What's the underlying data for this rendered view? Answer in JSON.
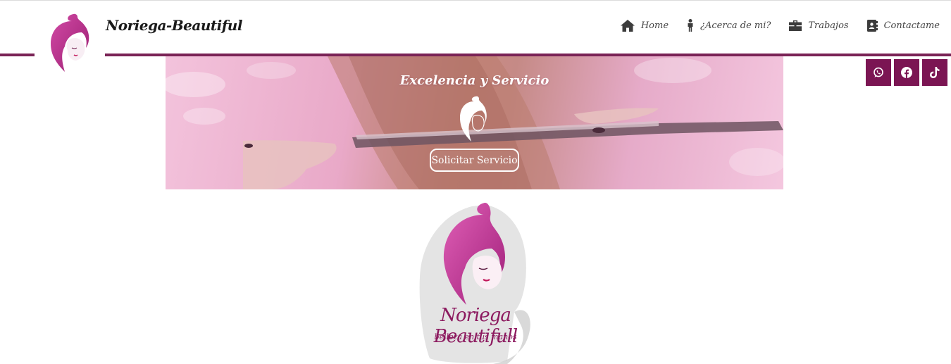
{
  "header": {
    "brand": "Noriega-Beautiful",
    "nav": [
      {
        "label": "Home",
        "icon": "home-icon"
      },
      {
        "label": "¿Acerca de mi?",
        "icon": "person-icon"
      },
      {
        "label": "Trabajos",
        "icon": "briefcase-icon"
      },
      {
        "label": "Contactame",
        "icon": "address-book-icon"
      }
    ],
    "accent_color": "#7a2356"
  },
  "social": [
    {
      "icon": "whatsapp-icon"
    },
    {
      "icon": "facebook-icon"
    },
    {
      "icon": "tiktok-icon"
    }
  ],
  "social_color": "#7b1553",
  "hero": {
    "title": "Excelencia y Servicio",
    "button_label": "Solicitar Servicio"
  },
  "logo": {
    "title": "Noriega Beautifull",
    "subtitle": "belleza en tus manos",
    "color": "#8c1a5f"
  }
}
